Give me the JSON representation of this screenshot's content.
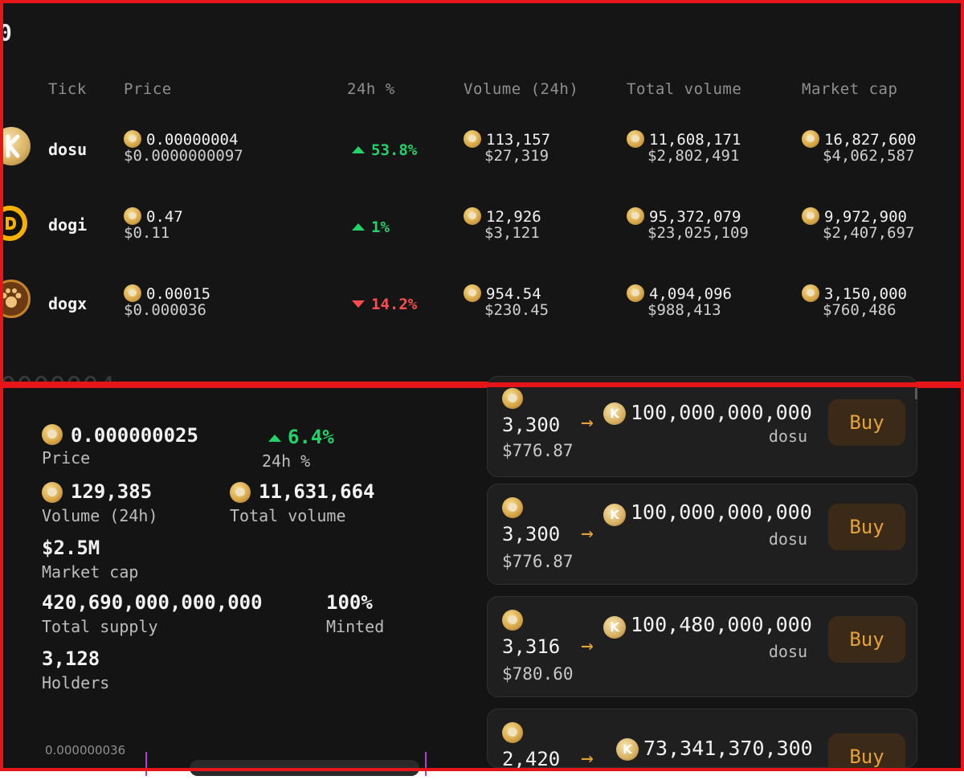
{
  "top": {
    "title_fragment": "0",
    "ghost_text": "0000004",
    "headers": {
      "tick": "Tick",
      "price": "Price",
      "change": "24h %",
      "volume": "Volume (24h)",
      "total_volume": "Total volume",
      "market_cap": "Market cap"
    },
    "rows": [
      {
        "tick": "dosu",
        "icon": "k-coin-icon",
        "price": "0.00000004",
        "price_usd": "$0.0000000097",
        "change": "53.8%",
        "direction": "up",
        "volume": "113,157",
        "volume_usd": "$27,319",
        "total_volume": "11,608,171",
        "total_volume_usd": "$2,802,491",
        "market_cap": "16,827,600",
        "market_cap_usd": "$4,062,587"
      },
      {
        "tick": "dogi",
        "icon": "d-coin-icon",
        "price": "0.47",
        "price_usd": "$0.11",
        "change": "1%",
        "direction": "up",
        "volume": "12,926",
        "volume_usd": "$3,121",
        "total_volume": "95,372,079",
        "total_volume_usd": "$23,025,109",
        "market_cap": "9,972,900",
        "market_cap_usd": "$2,407,697"
      },
      {
        "tick": "dogx",
        "icon": "paw-coin-icon",
        "price": "0.00015",
        "price_usd": "$0.000036",
        "change": "14.2%",
        "direction": "down",
        "volume": "954.54",
        "volume_usd": "$230.45",
        "total_volume": "4,094,096",
        "total_volume_usd": "$988,413",
        "market_cap": "3,150,000",
        "market_cap_usd": "$760,486"
      }
    ]
  },
  "stats": {
    "price": {
      "value": "0.000000025",
      "label": "Price"
    },
    "change": {
      "value": "6.4%",
      "label": "24h %"
    },
    "volume": {
      "value": "129,385",
      "label": "Volume (24h)"
    },
    "total_volume": {
      "value": "11,631,664",
      "label": "Total volume"
    },
    "market_cap": {
      "value": "$2.5M",
      "label": "Market cap"
    },
    "total_supply": {
      "value": "420,690,000,000,000",
      "label": "Total supply"
    },
    "minted": {
      "value": "100%",
      "label": "Minted"
    },
    "holders": {
      "value": "3,128",
      "label": "Holders"
    },
    "chart_axis_label": "0.000000036"
  },
  "orders": [
    {
      "amount": "3,300",
      "usd": "$776.87",
      "quantity": "100,000,000,000",
      "unit": "dosu",
      "buy": "Buy"
    },
    {
      "amount": "3,300",
      "usd": "$776.87",
      "quantity": "100,000,000,000",
      "unit": "dosu",
      "buy": "Buy"
    },
    {
      "amount": "3,316",
      "usd": "$780.60",
      "quantity": "100,480,000,000",
      "unit": "dosu",
      "buy": "Buy"
    },
    {
      "amount": "2,420",
      "usd": "",
      "quantity": "73,341,370,300",
      "unit": "",
      "buy": "Buy"
    }
  ],
  "colors": {
    "accent": "#e5a239",
    "up": "#22d36a",
    "down": "#ff4d4d",
    "frame": "#e6151a",
    "background": "#151515"
  }
}
